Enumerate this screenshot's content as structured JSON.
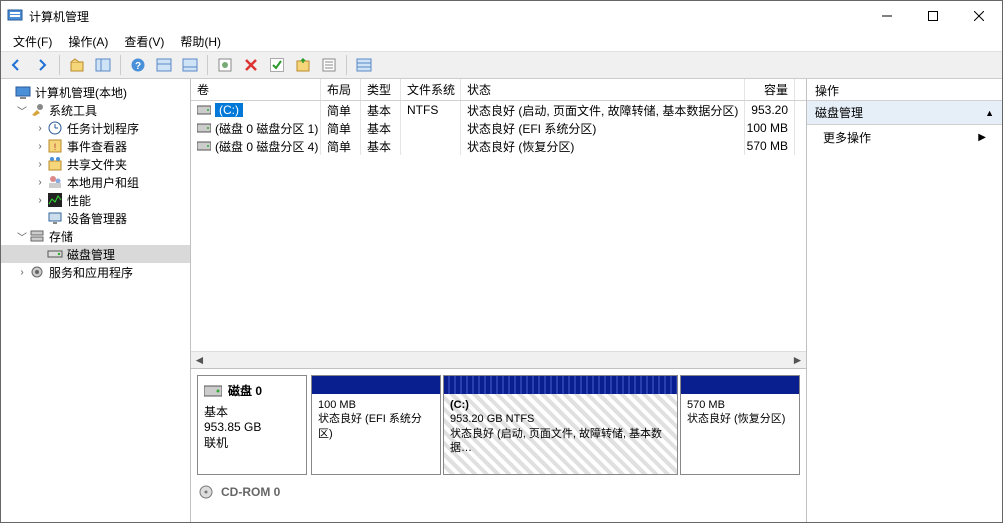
{
  "window": {
    "title": "计算机管理"
  },
  "menu": {
    "file": "文件(F)",
    "action": "操作(A)",
    "view": "查看(V)",
    "help": "帮助(H)"
  },
  "tree": {
    "root": "计算机管理(本地)",
    "system_tools": "系统工具",
    "task_scheduler": "任务计划程序",
    "event_viewer": "事件查看器",
    "shared_folders": "共享文件夹",
    "local_users": "本地用户和组",
    "performance": "性能",
    "device_manager": "设备管理器",
    "storage": "存储",
    "disk_management": "磁盘管理",
    "services": "服务和应用程序"
  },
  "vol_headers": {
    "volume": "卷",
    "layout": "布局",
    "type": "类型",
    "filesystem": "文件系统",
    "status": "状态",
    "capacity": "容量"
  },
  "volumes": [
    {
      "name": "(C:)",
      "layout": "简单",
      "type": "基本",
      "fs": "NTFS",
      "status": "状态良好 (启动, 页面文件, 故障转储, 基本数据分区)",
      "capacity": "953.20"
    },
    {
      "name": "(磁盘 0 磁盘分区 1)",
      "layout": "简单",
      "type": "基本",
      "fs": "",
      "status": "状态良好 (EFI 系统分区)",
      "capacity": "100 MB"
    },
    {
      "name": "(磁盘 0 磁盘分区 4)",
      "layout": "简单",
      "type": "基本",
      "fs": "",
      "status": "状态良好 (恢复分区)",
      "capacity": "570 MB"
    }
  ],
  "disk0": {
    "name": "磁盘 0",
    "type": "基本",
    "size": "953.85 GB",
    "status": "联机",
    "parts": [
      {
        "title": "",
        "line1": "100 MB",
        "line2": "状态良好 (EFI 系统分区)"
      },
      {
        "title": "(C:)",
        "line1": "953.20 GB NTFS",
        "line2": "状态良好 (启动, 页面文件, 故障转储, 基本数据…"
      },
      {
        "title": "",
        "line1": "570 MB",
        "line2": "状态良好 (恢复分区)"
      }
    ]
  },
  "cdrom": {
    "name": "CD-ROM 0"
  },
  "actions": {
    "header": "操作",
    "section": "磁盘管理",
    "more": "更多操作"
  }
}
